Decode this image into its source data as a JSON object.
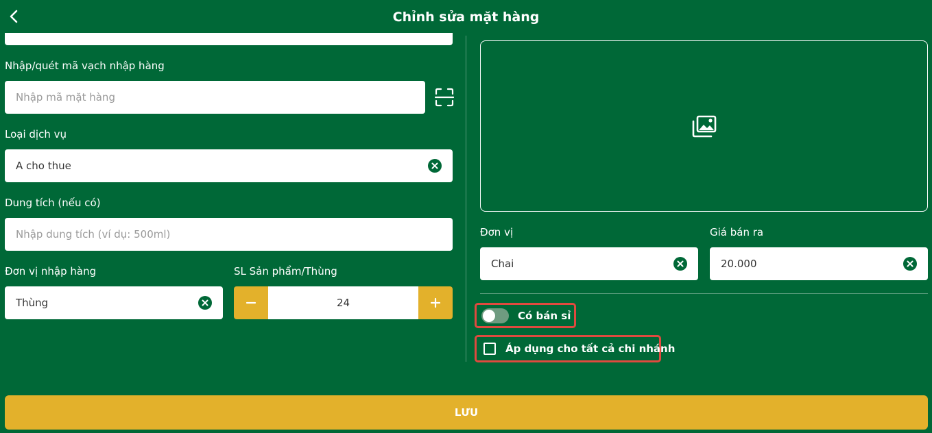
{
  "header": {
    "title": "Chỉnh sửa mặt hàng"
  },
  "barcode": {
    "label": "Nhập/quét mã vạch nhập hàng",
    "placeholder": "Nhập mã mặt hàng"
  },
  "service_type": {
    "label": "Loại dịch vụ",
    "value": "A cho thue"
  },
  "capacity": {
    "label": "Dung tích (nếu có)",
    "placeholder": "Nhập dung tích (ví dụ: 500ml)"
  },
  "import_unit": {
    "label": "Đơn vị nhập hàng",
    "value": "Thùng"
  },
  "per_box": {
    "label": "SL Sản phẩm/Thùng",
    "value": "24"
  },
  "unit": {
    "label": "Đơn vị",
    "value": "Chai"
  },
  "price": {
    "label": "Giá bán ra",
    "value": "20.000"
  },
  "wholesale": {
    "label": "Có bán sỉ",
    "enabled": false
  },
  "all_branches": {
    "label": "Áp dụng cho tất cả chi nhánh",
    "checked": false
  },
  "save": {
    "label": "LƯU"
  },
  "colors": {
    "background": "#006837",
    "accent": "#e3b12b",
    "highlight": "#e04a3f"
  }
}
